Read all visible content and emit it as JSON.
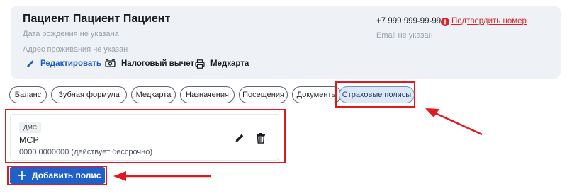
{
  "patient": {
    "name": "Пациент Пациент Пациент",
    "birth_date": "Дата рождения не указана",
    "address": "Адрес проживания не указан",
    "phone": "+7 999 999-99-99",
    "confirm_label": "Подтвердить номер",
    "email": "Email не указан"
  },
  "card_actions": {
    "edit_label": "Редактировать",
    "tax_label": "Налоговый вычет",
    "medcard_label": "Медкарта"
  },
  "tabs": [
    {
      "label": "Баланс",
      "active": false
    },
    {
      "label": "Зубная формула",
      "active": false
    },
    {
      "label": "Медкарта",
      "active": false
    },
    {
      "label": "Назначения",
      "active": false
    },
    {
      "label": "Посещения",
      "active": false
    },
    {
      "label": "Документы",
      "active": false
    },
    {
      "label": "Страховые полисы",
      "active": true
    }
  ],
  "policy": {
    "type_badge": "ДМС",
    "title": "МСР",
    "number_status": "0000 0000000 (действует бессрочно)"
  },
  "add_policy_label": "Добавить полис",
  "colors": {
    "accent": "#2060c9",
    "warning": "#d6242a",
    "annotation": "#e0191f"
  }
}
